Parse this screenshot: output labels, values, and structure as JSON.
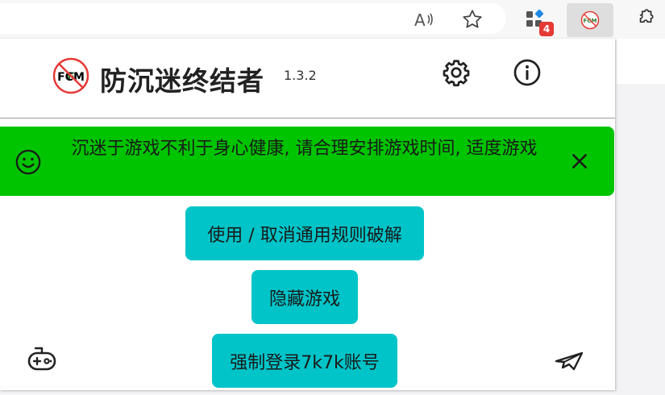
{
  "browser": {
    "read_aloud_icon": "read-aloud-icon",
    "favorite_icon": "star-icon",
    "extensions_icon": "extensions-icon",
    "extension_badge": "4",
    "fcm_icon_label": "FCM",
    "puzzle_icon": "puzzle-icon"
  },
  "popup": {
    "logo_text": "FCM",
    "title": "防沉迷终结者",
    "version": "1.3.2",
    "notice": {
      "text": "沉迷于游戏不利于身心健康, 请合理安排游戏时间, 适度游戏",
      "color": "#00c400"
    },
    "buttons": {
      "toggle_rules": "使用 / 取消通用规则破解",
      "hide_game": "隐藏游戏",
      "force_login": "强制登录7k7k账号"
    },
    "accent_color": "#00c4c8"
  }
}
